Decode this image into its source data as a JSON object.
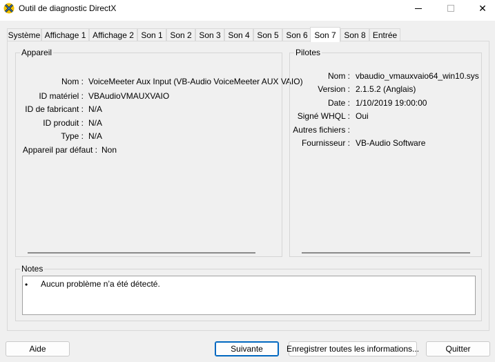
{
  "window": {
    "title": "Outil de diagnostic DirectX",
    "minimize_icon": "minimize-icon",
    "maximize_icon": "maximize-icon",
    "close_icon": "close-icon",
    "close_glyph": "✕",
    "app_icon": "directx-icon"
  },
  "tabs": [
    {
      "label": "Système"
    },
    {
      "label": "Affichage 1"
    },
    {
      "label": "Affichage 2"
    },
    {
      "label": "Son 1"
    },
    {
      "label": "Son 2"
    },
    {
      "label": "Son 3"
    },
    {
      "label": "Son 4"
    },
    {
      "label": "Son 5"
    },
    {
      "label": "Son 6"
    },
    {
      "label": "Son 7",
      "active": true
    },
    {
      "label": "Son 8"
    },
    {
      "label": "Entrée"
    }
  ],
  "device": {
    "title": "Appareil",
    "rows": [
      {
        "label": "Nom :",
        "value": "VoiceMeeter Aux Input (VB-Audio VoiceMeeter AUX VAIO)"
      },
      {
        "label": "ID matériel :",
        "value": "VBAudioVMAUXVAIO"
      },
      {
        "label": "ID de fabricant :",
        "value": "N/A"
      },
      {
        "label": "ID produit :",
        "value": "N/A"
      },
      {
        "label": "Type :",
        "value": "N/A"
      },
      {
        "label": "Appareil par défaut :",
        "value": "Non"
      }
    ]
  },
  "drivers": {
    "title": "Pilotes",
    "rows": [
      {
        "label": "Nom :",
        "value": "vbaudio_vmauxvaio64_win10.sys"
      },
      {
        "label": "Version :",
        "value": "2.1.5.2 (Anglais)"
      },
      {
        "label": "Date :",
        "value": "1/10/2019 19:00:00"
      },
      {
        "label": "Signé WHQL :",
        "value": "Oui"
      },
      {
        "label": "Autres fichiers :",
        "value": ""
      },
      {
        "label": "Fournisseur :",
        "value": "VB-Audio Software"
      }
    ]
  },
  "notes": {
    "title": "Notes",
    "bullet": "•",
    "text": "Aucun problème n’a été détecté."
  },
  "buttons": {
    "help": "Aide",
    "next": "Suivante",
    "save_all": "Enregistrer toutes les informations...",
    "quit": "Quitter"
  }
}
